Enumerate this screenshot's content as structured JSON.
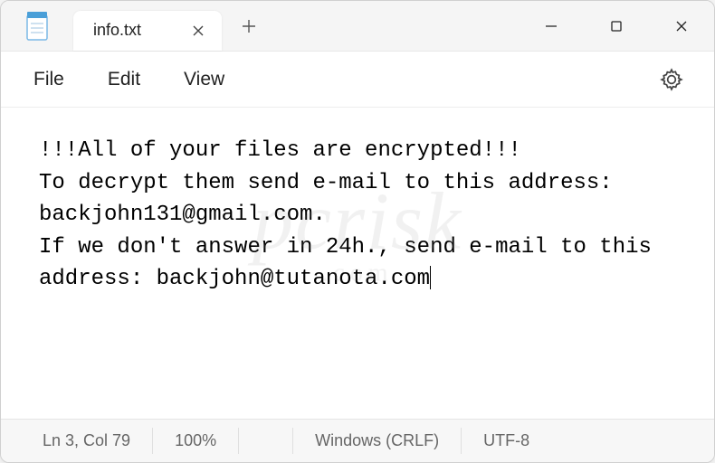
{
  "tab": {
    "title": "info.txt"
  },
  "menu": {
    "file": "File",
    "edit": "Edit",
    "view": "View"
  },
  "content": {
    "text": "!!!All of your files are encrypted!!!\nTo decrypt them send e-mail to this address: backjohn131@gmail.com.\nIf we don't answer in 24h., send e-mail to this address: backjohn@tutanota.com"
  },
  "statusbar": {
    "position": "Ln 3, Col 79",
    "zoom": "100%",
    "lineending": "Windows (CRLF)",
    "encoding": "UTF-8"
  },
  "watermark": {
    "main": "pcrisk",
    "sub": ".com"
  }
}
